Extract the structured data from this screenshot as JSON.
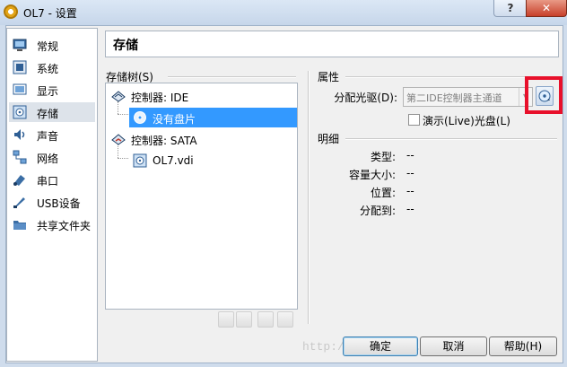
{
  "window": {
    "title": "OL7 - 设置",
    "help_label": "?",
    "close_label": "✕"
  },
  "nav": {
    "items": [
      {
        "label": "常规",
        "icon": "monitor-icon"
      },
      {
        "label": "系统",
        "icon": "chip-icon"
      },
      {
        "label": "显示",
        "icon": "display-icon"
      },
      {
        "label": "存储",
        "icon": "disk-icon",
        "selected": true
      },
      {
        "label": "声音",
        "icon": "speaker-icon"
      },
      {
        "label": "网络",
        "icon": "network-icon"
      },
      {
        "label": "串口",
        "icon": "serial-icon"
      },
      {
        "label": "USB设备",
        "icon": "usb-icon"
      },
      {
        "label": "共享文件夹",
        "icon": "folder-icon"
      }
    ]
  },
  "section_title": "存储",
  "storage_tree": {
    "label": "存储树(S)",
    "rows": [
      {
        "label": "控制器: IDE",
        "type": "controller"
      },
      {
        "label": "没有盘片",
        "type": "optical",
        "selected": true
      },
      {
        "label": "控制器: SATA",
        "type": "controller"
      },
      {
        "label": "OL7.vdi",
        "type": "harddisk"
      }
    ]
  },
  "attributes": {
    "label": "属性",
    "drive_label": "分配光驱(D):",
    "drive_value": "第二IDE控制器主通道",
    "live_cd_label": "演示(Live)光盘(L)"
  },
  "info": {
    "label": "明细",
    "rows": [
      {
        "label": "类型:",
        "value": "--"
      },
      {
        "label": "容量大小:",
        "value": "--"
      },
      {
        "label": "位置:",
        "value": "--"
      },
      {
        "label": "分配到:",
        "value": "--"
      }
    ]
  },
  "buttons": {
    "ok": "确定",
    "cancel": "取消",
    "help": "帮助(H)"
  },
  "watermark": "http://blog.csdn.net/"
}
